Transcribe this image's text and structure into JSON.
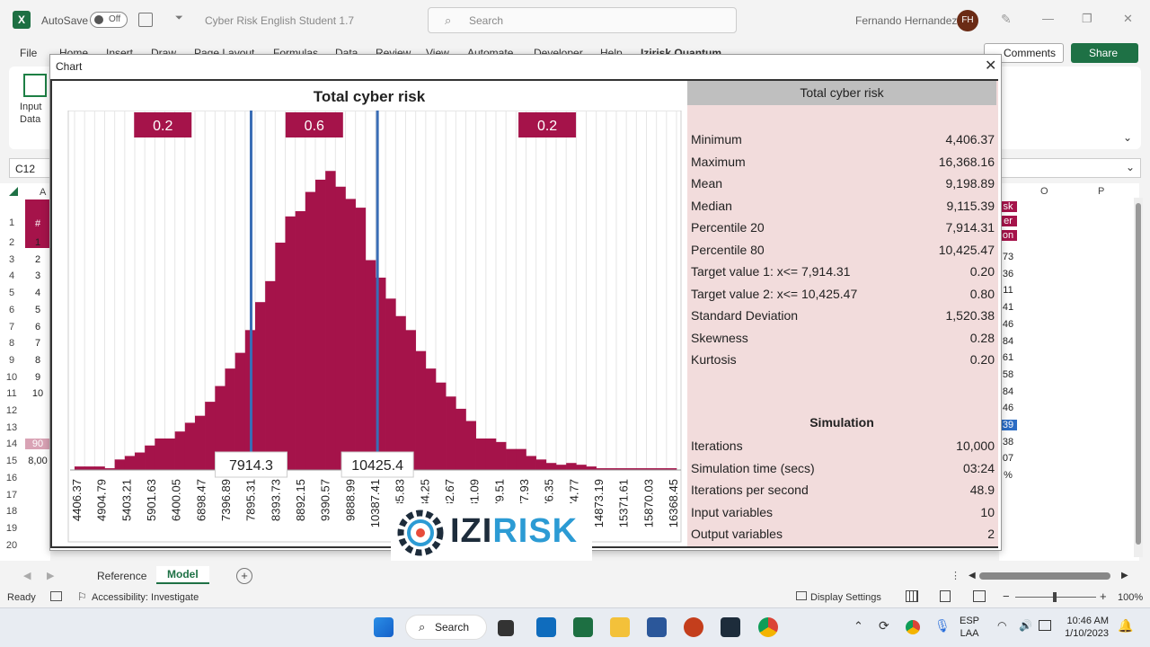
{
  "app": {
    "autosave_label": "AutoSave",
    "autosave_state": "Off",
    "doc_title": "Cyber Risk English Student 1.7",
    "search_placeholder": "Search",
    "user_name": "Fernando Hernandez",
    "user_initials": "FH"
  },
  "ribbon": {
    "tabs": [
      "File",
      "Home",
      "Insert",
      "Draw",
      "Page Layout",
      "Formulas",
      "Data",
      "Review",
      "View",
      "Automate",
      "Developer",
      "Help",
      "Izirisk Quantum"
    ],
    "comments_label": "Comments",
    "share_label": "Share",
    "input_data_line1": "Input",
    "input_data_line2": "Data"
  },
  "namebox": "C12",
  "columns": {
    "o": "O",
    "p": "P",
    "a": "A"
  },
  "rows_left": [
    {
      "n": "1",
      "a": "#"
    },
    {
      "n": "2",
      "a": "1"
    },
    {
      "n": "3",
      "a": "2"
    },
    {
      "n": "4",
      "a": "3"
    },
    {
      "n": "5",
      "a": "4"
    },
    {
      "n": "6",
      "a": "5"
    },
    {
      "n": "7",
      "a": "6"
    },
    {
      "n": "8",
      "a": "7"
    },
    {
      "n": "9",
      "a": "8"
    },
    {
      "n": "10",
      "a": "9"
    },
    {
      "n": "11",
      "a": "10"
    },
    {
      "n": "12",
      "a": ""
    },
    {
      "n": "13",
      "a": ""
    },
    {
      "n": "14",
      "a": "90"
    },
    {
      "n": "15",
      "a": "8,00"
    },
    {
      "n": "16",
      "a": ""
    },
    {
      "n": "17",
      "a": ""
    },
    {
      "n": "18",
      "a": ""
    },
    {
      "n": "19",
      "a": ""
    },
    {
      "n": "20",
      "a": ""
    }
  ],
  "right_col_values": [
    "sk",
    "er",
    "on",
    "73",
    "36",
    "11",
    "41",
    "46",
    "84",
    "61",
    "58",
    "84",
    "46",
    "39",
    "38",
    "07",
    "%"
  ],
  "dialog": {
    "title": "Chart",
    "close": "✕"
  },
  "chart_data": {
    "type": "bar",
    "title": "Total cyber risk",
    "bins_start": 4406.37,
    "bin_width": 249.21,
    "x_tick_labels": [
      "4406.37",
      "4904.79",
      "5403.21",
      "5901.63",
      "6400.05",
      "6898.47",
      "7396.89",
      "7895.31",
      "8393.73",
      "8892.15",
      "9390.57",
      "9888.99",
      "10387.41",
      "10885.83",
      "11384.25",
      "11882.67",
      "12381.09",
      "12879.51",
      "13377.93",
      "13876.35",
      "14374.77",
      "14873.19",
      "15371.61",
      "15870.03",
      "16368.45"
    ],
    "visible_tick_labels": [
      "4406.37",
      "4904.79",
      "5403.21",
      "5901.63",
      "6400.05",
      "6898.47",
      "7396.89",
      "7895.31",
      "8393.73",
      "8892.15",
      "9390.57",
      "9888.99",
      "10387.41",
      "34.25",
      "82.67",
      "81.09",
      "79.51",
      "77.93",
      "76.35",
      "74.77",
      "14873.19",
      "15371.61",
      "15870.03",
      "16368.45",
      "85.83"
    ],
    "frequencies": [
      0.002,
      0.002,
      0.002,
      0.001,
      0.006,
      0.008,
      0.01,
      0.014,
      0.018,
      0.018,
      0.022,
      0.027,
      0.031,
      0.039,
      0.048,
      0.058,
      0.067,
      0.08,
      0.096,
      0.108,
      0.13,
      0.145,
      0.148,
      0.159,
      0.166,
      0.171,
      0.162,
      0.155,
      0.15,
      0.12,
      0.11,
      0.098,
      0.088,
      0.08,
      0.068,
      0.058,
      0.05,
      0.042,
      0.035,
      0.028,
      0.018,
      0.018,
      0.016,
      0.012,
      0.012,
      0.008,
      0.006,
      0.004,
      0.003,
      0.004,
      0.003,
      0.002,
      0.001,
      0.001,
      0.001,
      0.001,
      0.001,
      0.001,
      0.001,
      0.001
    ],
    "target_lines": [
      7914.3,
      10425.4
    ],
    "target_labels": [
      "7914.3",
      "10425.4"
    ],
    "region_labels": [
      "0.2",
      "0.6",
      "0.2"
    ],
    "color": "#a5134a",
    "line_color": "#3a6db5"
  },
  "stats": {
    "header": "Total cyber risk",
    "rows": [
      {
        "label": "Minimum",
        "value": "4,406.37"
      },
      {
        "label": "Maximum",
        "value": "16,368.16"
      },
      {
        "label": "Mean",
        "value": "9,198.89"
      },
      {
        "label": "Median",
        "value": "9,115.39"
      },
      {
        "label": "Percentile 20",
        "value": "7,914.31"
      },
      {
        "label": "Percentile 80",
        "value": "10,425.47"
      },
      {
        "label": "Target value 1: x<= 7,914.31",
        "value": "0.20"
      },
      {
        "label": "Target value 2: x<= 10,425.47",
        "value": "0.80"
      },
      {
        "label": "Standard Deviation",
        "value": "1,520.38"
      },
      {
        "label": "Skewness",
        "value": "0.28"
      },
      {
        "label": "Kurtosis",
        "value": "0.20"
      }
    ],
    "simulation_header": "Simulation",
    "sim_rows": [
      {
        "label": "Iterations",
        "value": "10,000"
      },
      {
        "label": "Simulation time (secs)",
        "value": "03:24"
      },
      {
        "label": "Iterations per second",
        "value": "48.9"
      },
      {
        "label": "Input variables",
        "value": "10"
      },
      {
        "label": "Output variables",
        "value": "2"
      }
    ]
  },
  "logo": {
    "part1": "IZI",
    "part2": "RISK"
  },
  "sheets": {
    "reference": "Reference",
    "model": "Model",
    "add": "+"
  },
  "status": {
    "ready": "Ready",
    "accessibility": "Accessibility: Investigate",
    "display_settings": "Display Settings",
    "zoom": "100%"
  },
  "taskbar": {
    "search": "Search",
    "lang1": "ESP",
    "lang2": "LAA",
    "time": "10:46 AM",
    "date": "1/10/2023"
  }
}
